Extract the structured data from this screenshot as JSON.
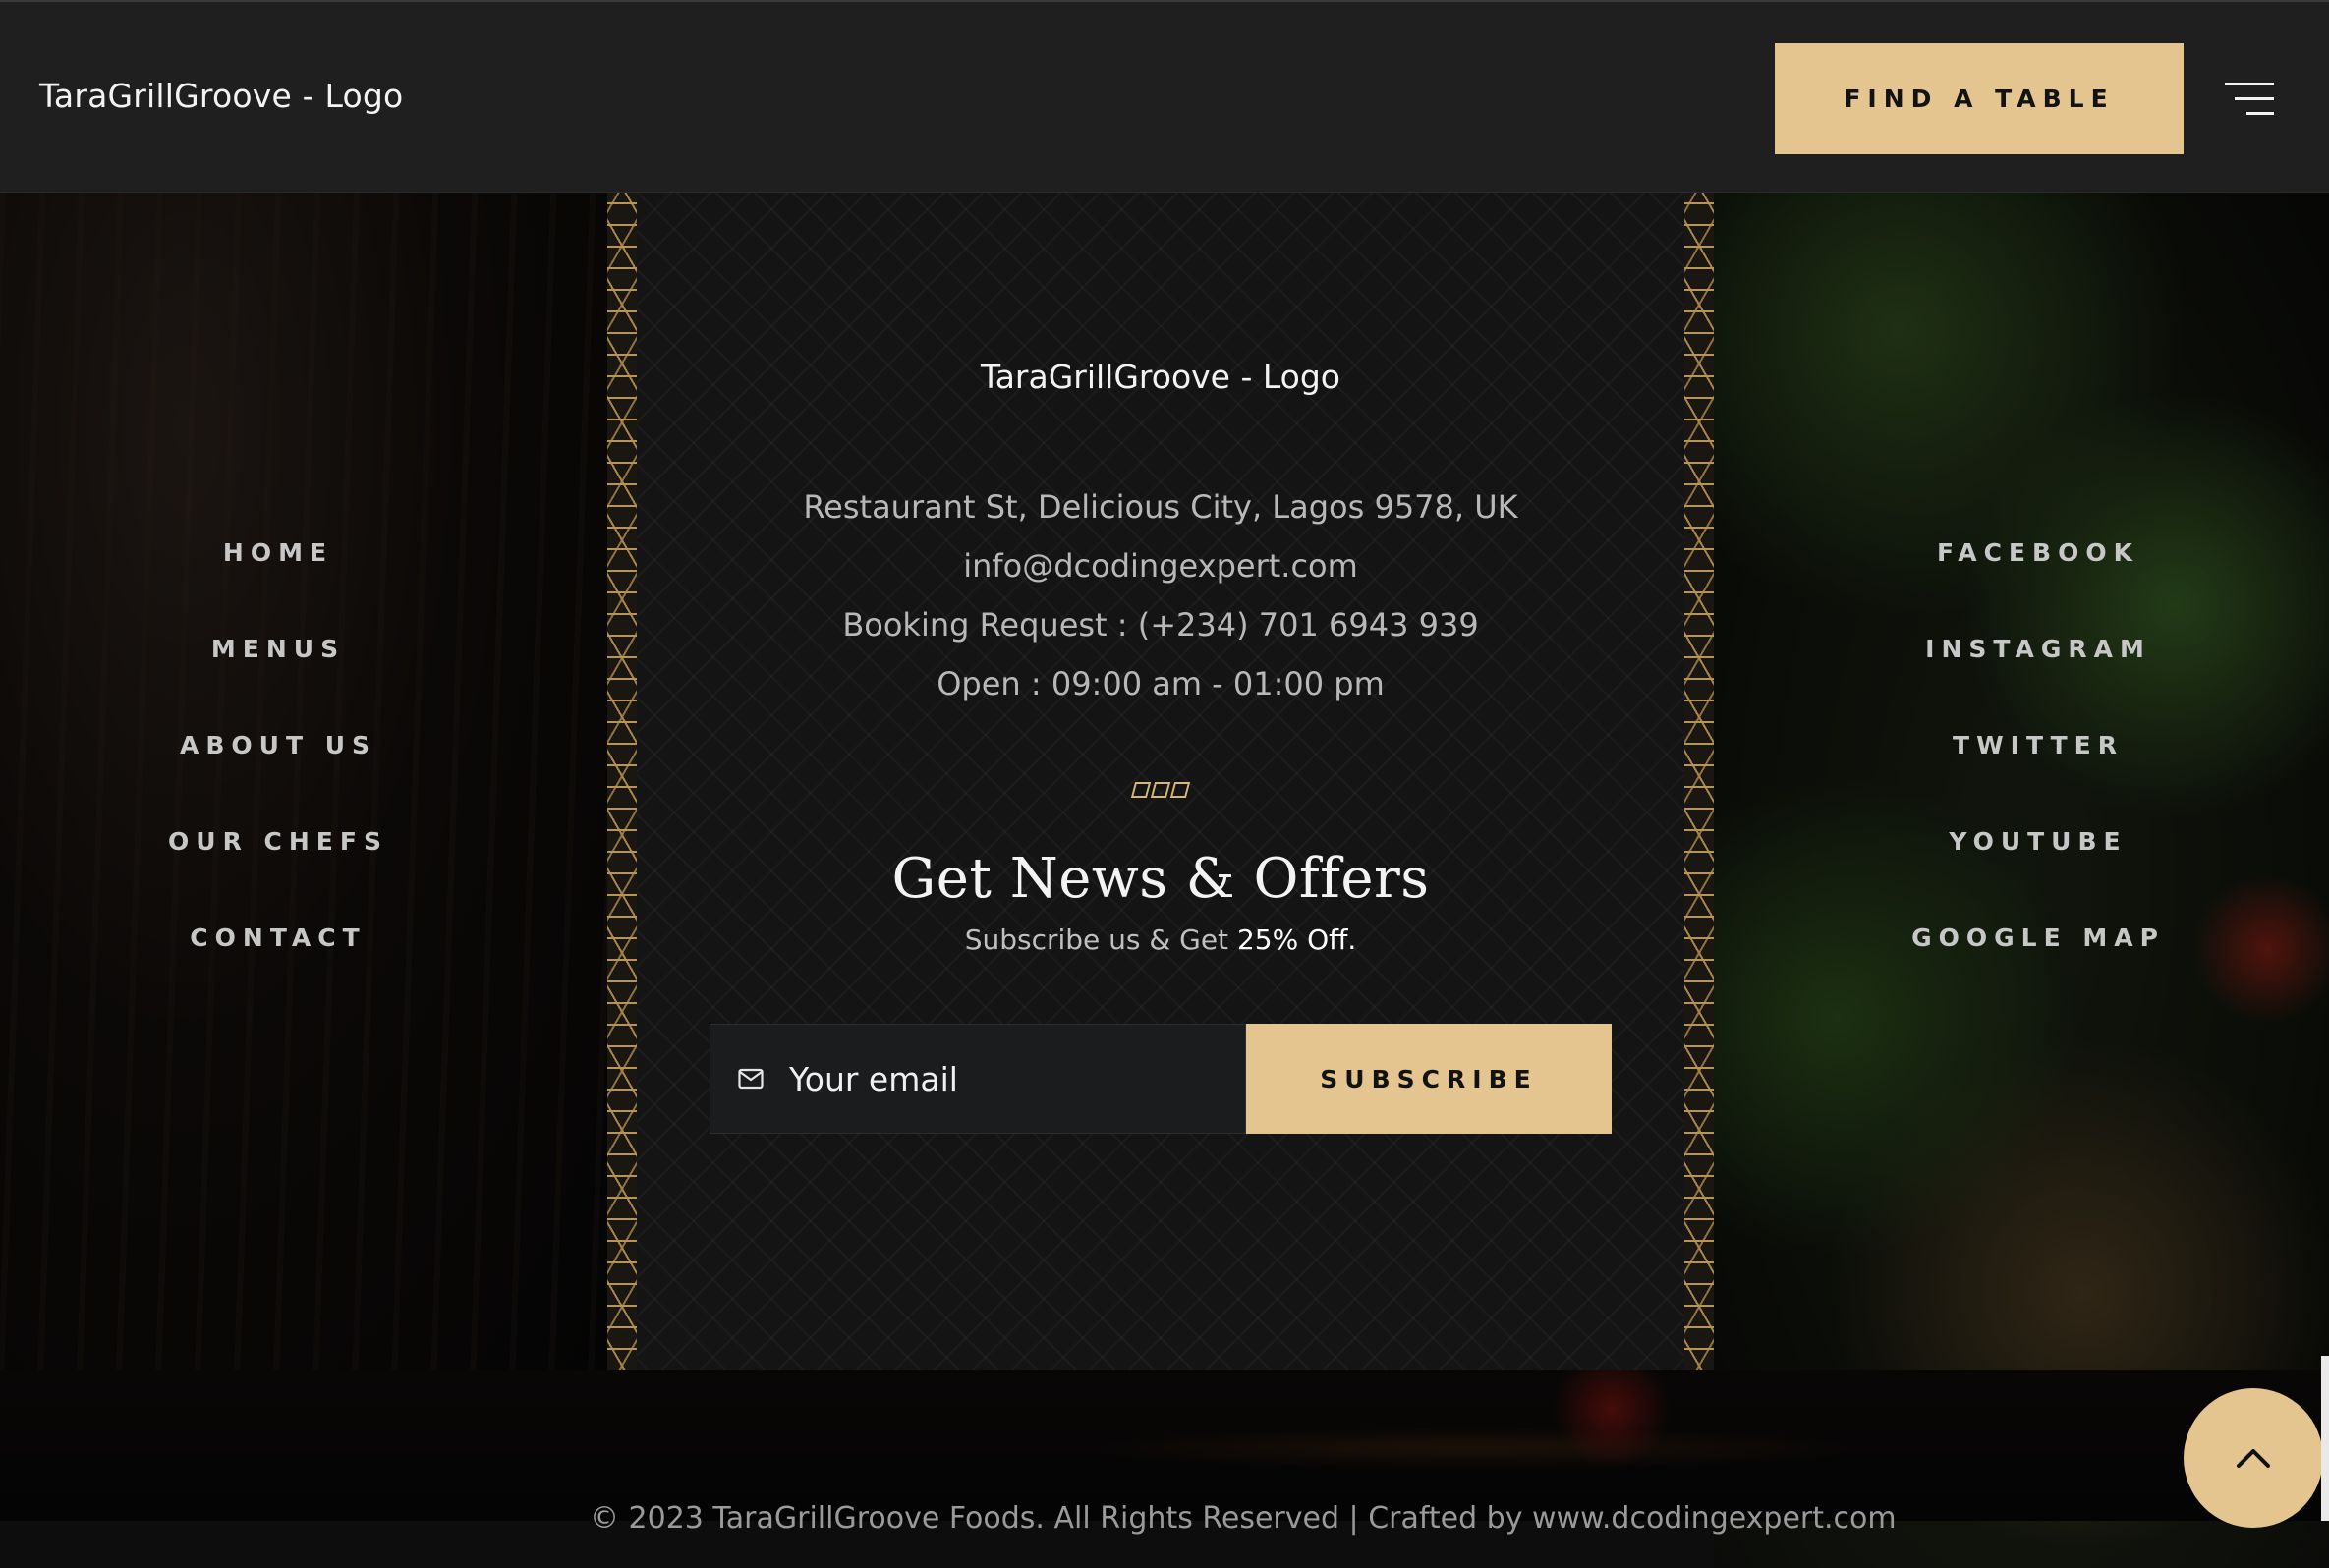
{
  "header": {
    "logo": "TaraGrillGroove - Logo",
    "find_table": "FIND A TABLE",
    "menu_icon": "hamburger-menu-icon"
  },
  "nav_left": [
    "HOME",
    "MENUS",
    "ABOUT US",
    "OUR CHEFS",
    "CONTACT"
  ],
  "nav_right": [
    "FACEBOOK",
    "INSTAGRAM",
    "TWITTER",
    "YOUTUBE",
    "GOOGLE MAP"
  ],
  "panel": {
    "logo": "TaraGrillGroove - Logo",
    "address": "Restaurant St, Delicious City, Lagos 9578, UK",
    "email": "info@dcodingexpert.com",
    "booking": "Booking Request : (+234) 701 6943 939",
    "hours": "Open : 09:00 am - 01:00 pm",
    "title": "Get News & Offers",
    "subtitle_prefix": "Subscribe us & Get",
    "subtitle_highlight": "25% Off.",
    "email_placeholder": "Your email",
    "subscribe": "SUBSCRIBE"
  },
  "footer": {
    "copyright": "© 2023 TaraGrillGroove Foods. All Rights Reserved | Crafted by www.dcodingexpert.com"
  },
  "colors": {
    "accent": "#e4c590",
    "header_bg": "#1f1f20",
    "panel_bg": "#141414"
  }
}
